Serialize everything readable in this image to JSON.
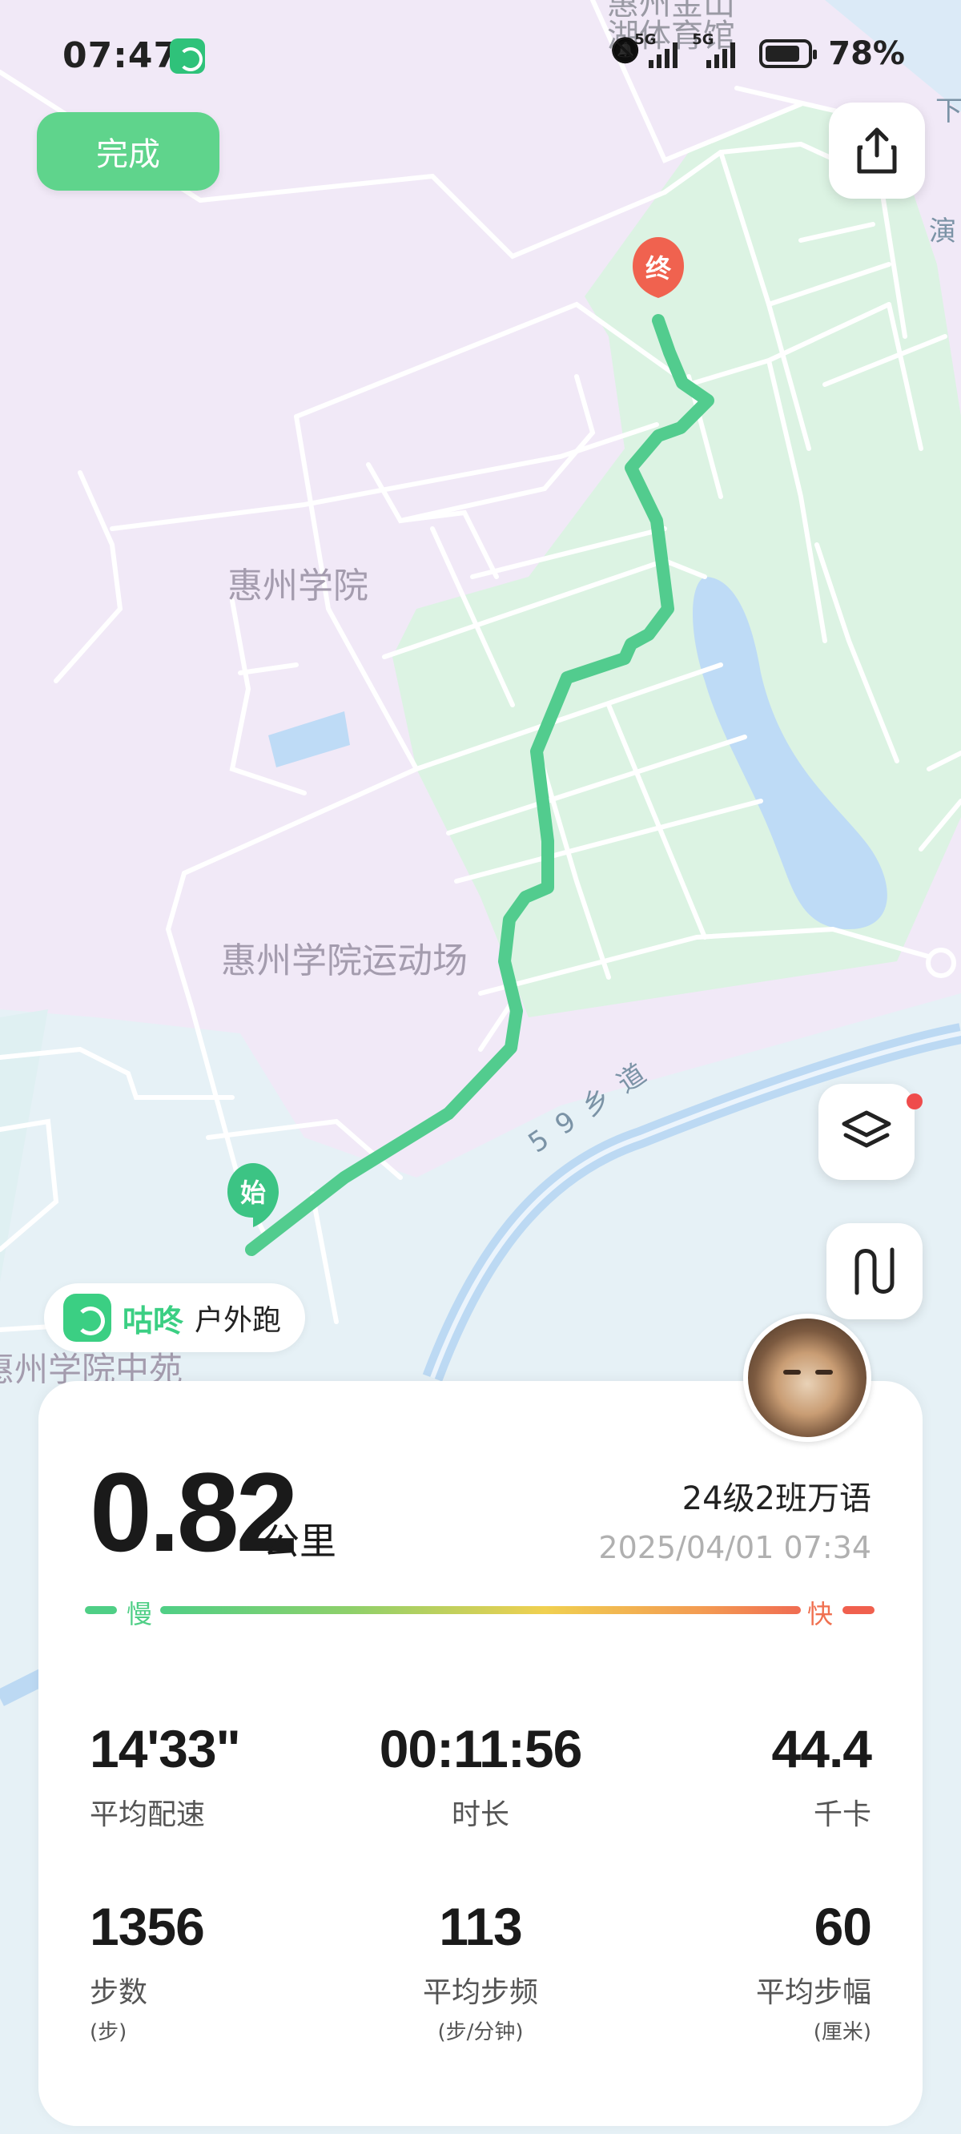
{
  "status_bar": {
    "time": "07:47",
    "network_1": "5G",
    "network_2": "5G",
    "battery": "78%"
  },
  "header": {
    "done_label": "完成"
  },
  "map": {
    "labels": {
      "top_label_1": "惠州金山",
      "top_label_2": "湖体育馆",
      "huizhou_college": "惠州学院",
      "sports_field": "惠州学院运动场",
      "road_59": "5 9 乡 道",
      "middle_garden": "惠州学院中苑",
      "right_edge_1": "下",
      "right_edge_2": "演"
    },
    "start_marker": "始",
    "end_marker": "终"
  },
  "brand": {
    "name": "咕咚",
    "activity_type": "户外跑"
  },
  "summary": {
    "distance": "0.82",
    "distance_unit": "公里",
    "user_name": "24级2班万语",
    "date": "2025/04/01 07:34",
    "speed_slow": "慢",
    "speed_fast": "快"
  },
  "stats": [
    {
      "value": "14'33\"",
      "label": "平均配速",
      "sub": ""
    },
    {
      "value": "00:11:56",
      "label": "时长",
      "sub": ""
    },
    {
      "value": "44.4",
      "label": "千卡",
      "sub": ""
    },
    {
      "value": "1356",
      "label": "步数",
      "sub": "(步)"
    },
    {
      "value": "113",
      "label": "平均步频",
      "sub": "(步/分钟)"
    },
    {
      "value": "60",
      "label": "平均步幅",
      "sub": "(厘米)"
    }
  ],
  "colors": {
    "accent_green": "#5fd48c",
    "route_green": "#52cc8e",
    "end_red": "#f0624f"
  }
}
